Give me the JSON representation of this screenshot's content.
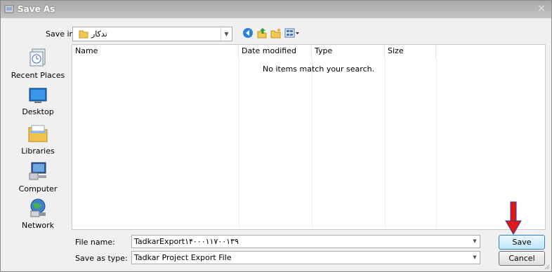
{
  "window": {
    "title": "Save As",
    "close_glyph": "×"
  },
  "save_in": {
    "label": "Save in:",
    "value": "تدکار"
  },
  "toolbar": {
    "icons": [
      "back-icon",
      "up-folder-icon",
      "new-folder-icon",
      "views-menu-icon"
    ]
  },
  "places": [
    {
      "label": "Recent Places",
      "icon": "recent-places-icon"
    },
    {
      "label": "Desktop",
      "icon": "desktop-icon"
    },
    {
      "label": "Libraries",
      "icon": "libraries-icon"
    },
    {
      "label": "Computer",
      "icon": "computer-icon"
    },
    {
      "label": "Network",
      "icon": "network-icon"
    }
  ],
  "file_list": {
    "columns": [
      "Name",
      "Date modified",
      "Type",
      "Size"
    ],
    "empty_message": "No items match your search."
  },
  "file_name": {
    "label": "File name:",
    "value": "TadkarExport۱۴۰۰۰۱۱۷۰۰۱۳۹"
  },
  "save_as_type": {
    "label": "Save as type:",
    "value": "Tadkar Project Export File"
  },
  "buttons": {
    "save": "Save",
    "cancel": "Cancel"
  },
  "colors": {
    "title_bar": "#b4b4b4",
    "annotation_arrow": "#e01818"
  }
}
